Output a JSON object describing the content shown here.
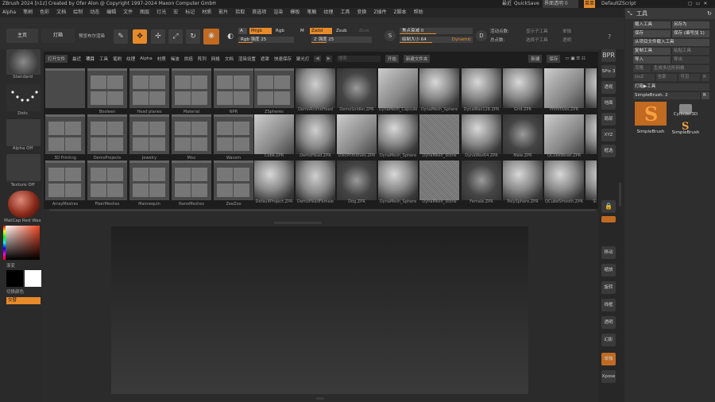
{
  "window": {
    "title": "ZBrush 2024 [n1z] Created by Ofer Alon @ Copyright 1997-2024 Maxon Computer GmbH",
    "recent": "最近",
    "quicksave": "QuickSave",
    "ui_transparency": "界面透明 0",
    "menu_button": "菜单",
    "script": "DefaultZScript"
  },
  "menu": [
    "Alpha",
    "笔刷",
    "色彩",
    "文档",
    "绘制",
    "动态",
    "编辑",
    "文件",
    "图层",
    "灯光",
    "宏",
    "标记",
    "材质",
    "影片",
    "拾取",
    "首选项",
    "渲染",
    "模板",
    "笔触",
    "纹理",
    "工具",
    "变换",
    "Z插件",
    "Z脚本",
    "帮助"
  ],
  "toolbar": {
    "home": "主页",
    "lightbox": "灯箱",
    "bpr": "预览布尔渲染",
    "edit": "Edit",
    "draw": "绘制",
    "move": "移动",
    "scale": "缩放",
    "rotate": "旋转",
    "a_label": "A",
    "mrgb": "Mrgb",
    "rgb": "Rgb",
    "m": "M",
    "zadd": "Zadd",
    "zsub": "Zsub",
    "zcut": "Zcut",
    "rgb_intensity": "Rgb 强度 25",
    "z_intensity": "Z 强度 25",
    "focal_shift": "焦点衰减 0",
    "draw_size": "绘制大小 64",
    "dynamic": "Dynamic",
    "active_points": "活动点数:",
    "total_points": "总点数:",
    "show_subtools": "显示子工具",
    "select_subtool": "选择子工具",
    "solo": "单独",
    "transp": "透明",
    "focal_value": 0.5,
    "draw_value": 0.45
  },
  "leftshelf": {
    "brush": "Standard",
    "stroke": "Dots",
    "alpha": "Alpha Off",
    "texture": "Texture Off",
    "material": "MatCap Red Wax",
    "gradient": "渐变",
    "switch_color": "切换颜色",
    "alternate": "交替"
  },
  "lightbox": {
    "tabs": [
      "打开文件",
      "最近",
      "项目",
      "工具",
      "笔刷",
      "纹理",
      "Alpha",
      "材质",
      "噪波",
      "烘焙",
      "阵列",
      "网格",
      "文档",
      "渲染设置",
      "遮罩",
      "快速保存",
      "聚光灯"
    ],
    "search_hint": "搜索",
    "open_btn": "开始",
    "newfolder": "新建文件夹",
    "newfile": "新建",
    "savebtn": "保存",
    "rows": [
      [
        "",
        "Booleen",
        "Head planes",
        "Material",
        "NPR",
        "ZSpheres",
        "DemoAnimeHead",
        "DemoSoldier.ZPR",
        "DynaMesh_Capsule",
        "DynaMesh_Sphere",
        "DynaWax128.ZPR",
        "Grid.ZPR",
        "Primitives.ZPR",
        "QCube"
      ],
      [
        "3D Printing",
        "DemoProjects",
        "Jewelry",
        "Misc",
        "Wacom",
        "Cube.ZPR",
        "DemoHead.ZPR",
        "DiscPrimitives.ZPR",
        "DynaMesh_Sphere",
        "DynaMesh_Stone",
        "DynaWax64.ZPR",
        "Male.ZPR",
        "QCubeBevel.ZPR",
        "RS_Dyna"
      ],
      [
        "ArrayMeshes",
        "FiberMeshes",
        "Mannequin",
        "NanoMeshes",
        "ZeeZoo",
        "DefaultProject.ZPR",
        "DemoHeadFemale",
        "Dog.ZPR",
        "DynaMesh_Sphere",
        "DynaMesh_Stone",
        "Female.ZPR",
        "PolySphere.ZPR",
        "QCubeSmooth.ZPR",
        "SimpleBrush"
      ]
    ]
  },
  "rightshelf": {
    "bpr": "BPR",
    "spix": "SPix 3",
    "persp": "透视",
    "floor": "地面",
    "local": "局部",
    "xyz": "XYZ",
    "frame": "框选",
    "move": "移动",
    "zoom3d": "缩放",
    "rotate": "旋转",
    "polyf": "线框",
    "transp": "透明",
    "ghost": "幻影",
    "solo": "单独",
    "xpose": "Xpose"
  },
  "rightpanel": {
    "title": "工具",
    "load_tool": "载入工具",
    "save_as": "另存为",
    "save": "保存",
    "save_numbered": "保存 (编号加 1)",
    "load_from_project": "从项目文件载入工具",
    "copy_tool": "复制工具",
    "paste_tool": "粘贴工具",
    "import": "导入",
    "export": "导出",
    "clone": "克隆",
    "make_polymesh": "生成多边形网格",
    "goz": "GoZ",
    "all": "全部",
    "visible": "可见",
    "r": "R",
    "lightbox_tools": "灯箱▶工具",
    "current_tool": "SimpleBrush. 2",
    "r_small": "R",
    "brush1": "SimpleBrush",
    "brush2": "Cylinder3D",
    "brush3": "SimpleBrush"
  }
}
